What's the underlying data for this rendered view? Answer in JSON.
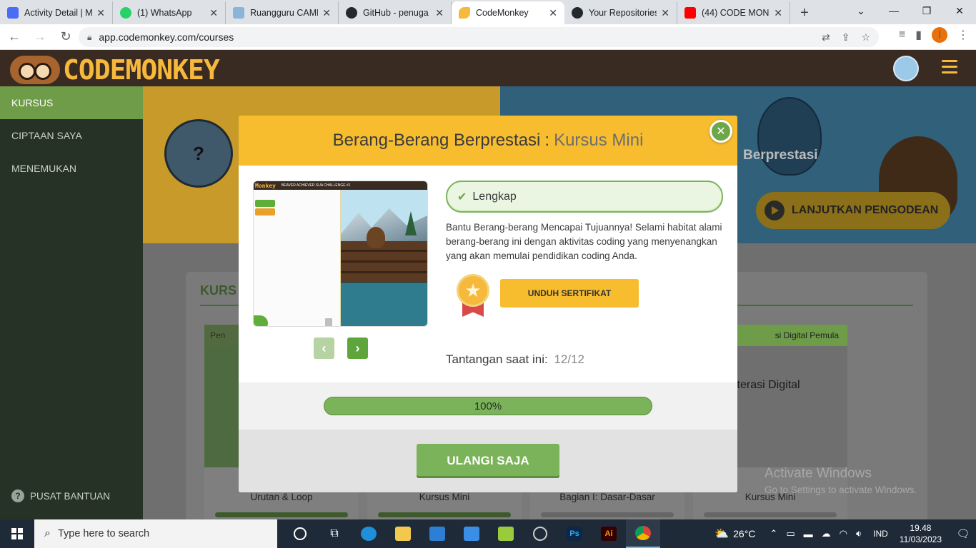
{
  "browser": {
    "tabs": [
      {
        "title": "Activity Detail | M",
        "color": "#4a6cf7"
      },
      {
        "title": "(1) WhatsApp",
        "color": "#25d366"
      },
      {
        "title": "Ruangguru CAMP",
        "color": "#8ab4d8"
      },
      {
        "title": "GitHub - penuga",
        "color": "#24292e"
      },
      {
        "title": "CodeMonkey",
        "color": "#f6b93b"
      },
      {
        "title": "Your Repositories",
        "color": "#24292e"
      },
      {
        "title": "(44) CODE MON",
        "color": "#ff0000"
      }
    ],
    "url": "app.codemonkey.com/courses",
    "profile_initial": "I"
  },
  "header": {
    "logo_text": "CODEMONKEY"
  },
  "sidebar": {
    "items": [
      {
        "label": "KURSUS"
      },
      {
        "label": "CIPTAAN SAYA"
      },
      {
        "label": "MENEMUKAN"
      }
    ],
    "help_label": "PUSAT BANTUAN"
  },
  "banner": {
    "course_name_partial": "Berprestasi",
    "avatar_symbol": "?",
    "continue_label": "LANJUTKAN PENGODEAN"
  },
  "courses": {
    "heading_partial": "KURS",
    "cards": [
      {
        "badge": "Pen",
        "name": "Urutan & Loop"
      },
      {
        "badge": "",
        "name": "Kursus Mini"
      },
      {
        "badge": "",
        "name": "Bagian I: Dasar-Dasar"
      },
      {
        "badge": "si Digital   Pemula",
        "name": "Kursus Mini"
      }
    ],
    "card4_title": "iterasi Digital"
  },
  "modal": {
    "title": "Berang-Berang Berprestasi",
    "title_separator": ":",
    "subtitle": "Kursus Mini",
    "status_label": "Lengkap",
    "description": "Bantu Berang-berang Mencapai Tujuannya! Selami habitat alami berang-berang ini dengan aktivitas coding yang menyenangkan yang akan memulai pendidikan coding Anda.",
    "certificate_button": "UNDUH SERTIFIKAT",
    "challenge_label": "Tantangan saat ini:",
    "challenge_value": "12/12",
    "progress": 1.0,
    "progress_label": "100%",
    "replay_button": "ULANGI SAJA",
    "preview_logo": "Monkey",
    "preview_title": "BEAVER ACHIEVER SUA CHALLENGE #1"
  },
  "watermark": {
    "line1": "Activate Windows",
    "line2": "Go to Settings to activate Windows."
  },
  "taskbar": {
    "search_placeholder": "Type here to search",
    "temperature": "26°C",
    "language": "IND",
    "time": "19.48",
    "date": "11/03/2023"
  }
}
